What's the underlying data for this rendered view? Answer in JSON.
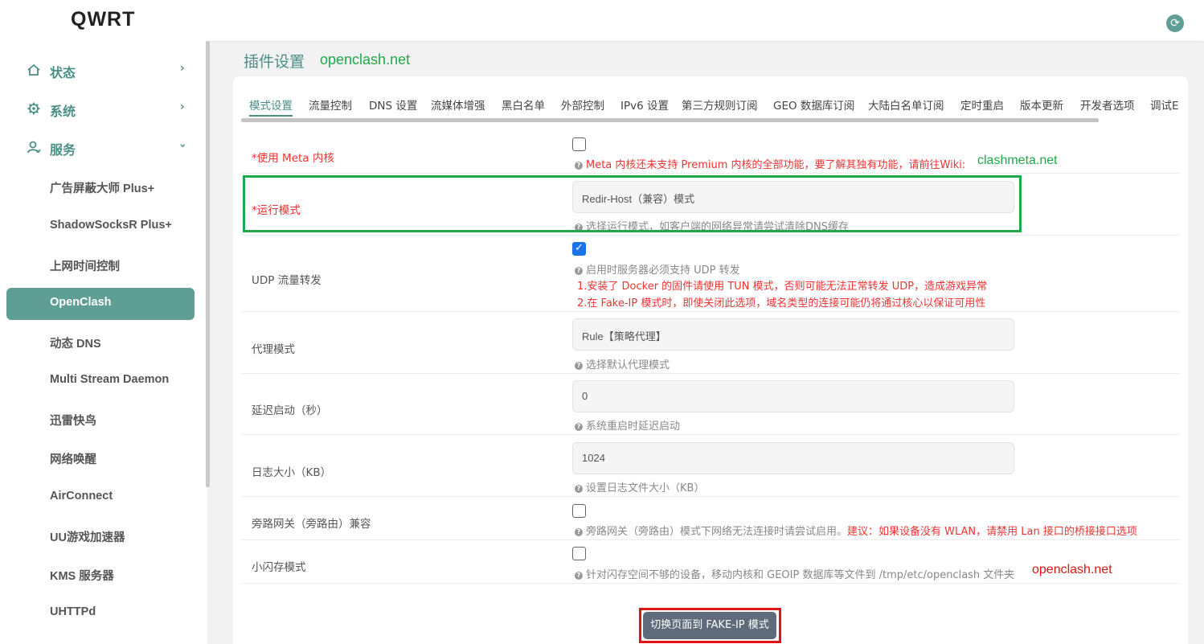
{
  "app": {
    "brand": "QWRT"
  },
  "sidebar": {
    "top_items": [
      {
        "label": "状态",
        "icon": "home-icon"
      },
      {
        "label": "系统",
        "icon": "gear-icon"
      },
      {
        "label": "服务",
        "icon": "user-icon"
      }
    ],
    "sub_items": [
      {
        "label": "广告屏蔽大师 Plus+"
      },
      {
        "label": "ShadowSocksR Plus+"
      },
      {
        "label": "上网时间控制"
      },
      {
        "label": "OpenClash",
        "active": true
      },
      {
        "label": "动态 DNS"
      },
      {
        "label": "Multi Stream Daemon"
      },
      {
        "label": "迅雷快鸟"
      },
      {
        "label": "网络唤醒"
      },
      {
        "label": "AirConnect"
      },
      {
        "label": "UU游戏加速器"
      },
      {
        "label": "KMS 服务器"
      },
      {
        "label": "UHTTPd"
      }
    ]
  },
  "header": {
    "title": "插件设置",
    "watermark": "openclash.net"
  },
  "tabs": [
    {
      "label": "模式设置",
      "active": true
    },
    {
      "label": "流量控制"
    },
    {
      "label": "DNS 设置"
    },
    {
      "label": "流媒体增强"
    },
    {
      "label": "黑白名单"
    },
    {
      "label": "外部控制"
    },
    {
      "label": "IPv6 设置"
    },
    {
      "label": "第三方规则订阅"
    },
    {
      "label": "GEO 数据库订阅"
    },
    {
      "label": "大陆白名单订阅"
    },
    {
      "label": "定时重启"
    },
    {
      "label": "版本更新"
    },
    {
      "label": "开发者选项"
    },
    {
      "label": "调试E"
    }
  ],
  "rows": {
    "meta": {
      "label": "*使用 Meta 内核",
      "checked": false,
      "hint": "Meta 内核还未支持 Premium 内核的全部功能，要了解其独有功能，请前往Wiki:",
      "wiki": "clashmeta.net"
    },
    "run_mode": {
      "label": "*运行模式",
      "value": "Redir-Host（兼容）模式",
      "hint": "选择运行模式，如客户端的网络异常请尝试清除DNS缓存"
    },
    "udp": {
      "label": "UDP 流量转发",
      "checked": true,
      "hint": "启用时服务器必须支持 UDP 转发",
      "note1": "1.安装了 Docker 的固件请使用 TUN 模式，否则可能无法正常转发 UDP，造成游戏异常",
      "note2": "2.在 Fake-IP 模式时，即使关闭此选项，域名类型的连接可能仍将通过核心以保证可用性"
    },
    "proxy_mode": {
      "label": "代理模式",
      "value": "Rule【策略代理】",
      "hint": "选择默认代理模式"
    },
    "delay": {
      "label": "延迟启动（秒）",
      "value": "0",
      "hint": "系统重启时延迟启动"
    },
    "log_size": {
      "label": "日志大小（KB）",
      "value": "1024",
      "hint": "设置日志文件大小（KB）"
    },
    "bypass": {
      "label": "旁路网关（旁路由）兼容",
      "checked": false,
      "hint": "旁路网关（旁路由）模式下网络无法连接时请尝试启用。",
      "hint_red": "建议：如果设备没有 WLAN，请禁用 Lan 接口的桥接接口选项"
    },
    "small_flash": {
      "label": "小闪存模式",
      "checked": false,
      "hint": "针对闪存空间不够的设备，移动内核和 GEOIP 数据库等文件到 /tmp/etc/openclash 文件夹",
      "watermark": "openclash.net"
    }
  },
  "actions": {
    "switch_label": "切换页面到 FAKE-IP 模式"
  },
  "colors": {
    "accent": "#5f9e94",
    "required": "#e33333",
    "watermark_green": "#1fa84a",
    "highlight_red": "#e01414",
    "checkbox_blue": "#1a73e8"
  }
}
